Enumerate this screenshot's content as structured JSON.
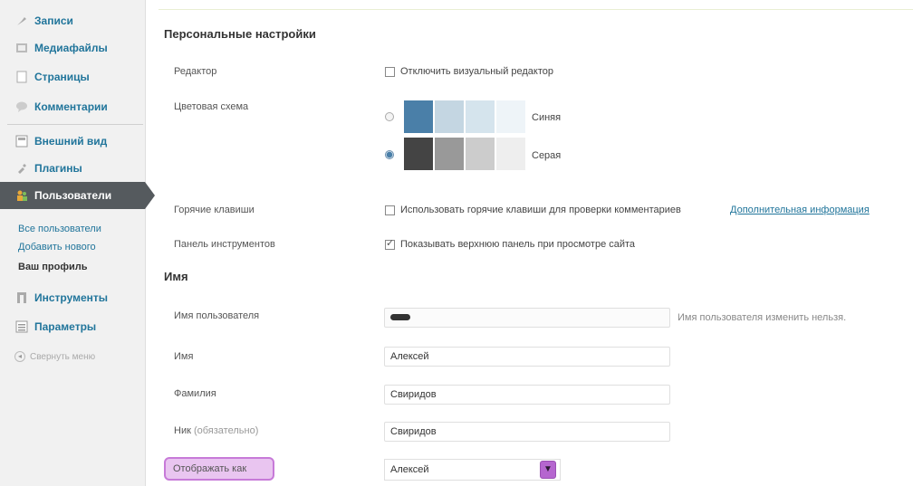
{
  "sidebar": {
    "items": [
      {
        "label": "Записи",
        "icon": "pin-icon"
      },
      {
        "label": "Медиафайлы",
        "icon": "media-icon"
      },
      {
        "label": "Страницы",
        "icon": "pages-icon"
      },
      {
        "label": "Комментарии",
        "icon": "comments-icon"
      },
      {
        "label": "Внешний вид",
        "icon": "appearance-icon"
      },
      {
        "label": "Плагины",
        "icon": "plugins-icon"
      },
      {
        "label": "Пользователи",
        "icon": "users-icon"
      },
      {
        "label": "Инструменты",
        "icon": "tools-icon"
      },
      {
        "label": "Параметры",
        "icon": "settings-icon"
      }
    ],
    "submenu": [
      "Все пользователи",
      "Добавить нового",
      "Ваш профиль"
    ],
    "collapse": "Свернуть меню",
    "active_color": "#555a5e",
    "link_color": "#21759b"
  },
  "main": {
    "personal_heading": "Персональные настройки",
    "editor_label": "Редактор",
    "editor_checkbox": "Отключить визуальный редактор",
    "color_scheme_label": "Цветовая схема",
    "schemes": [
      {
        "name": "Синяя",
        "selected": false,
        "colors": [
          "#4a7fa8",
          "#c4d6e2",
          "#d5e4ed",
          "#eef4f8"
        ]
      },
      {
        "name": "Серая",
        "selected": true,
        "colors": [
          "#444444",
          "#999999",
          "#cccccc",
          "#eeeeee"
        ]
      }
    ],
    "hotkeys_label": "Горячие клавиши",
    "hotkeys_checkbox": "Использовать горячие клавиши для проверки комментариев",
    "hotkeys_link": "Дополнительная информация",
    "toolbar_label": "Панель инструментов",
    "toolbar_checkbox": "Показывать верхнюю панель при просмотре сайта",
    "toolbar_checked": true,
    "name_heading": "Имя",
    "username_label": "Имя пользователя",
    "username_note": "Имя пользователя изменить нельзя.",
    "firstname_label": "Имя",
    "firstname_value": "Алексей",
    "lastname_label": "Фамилия",
    "lastname_value": "Свиридов",
    "nickname_label": "Ник",
    "nickname_note": "(обязательно)",
    "nickname_value": "Свиридов",
    "display_as_label": "Отображать как",
    "display_as_value": "Алексей"
  }
}
